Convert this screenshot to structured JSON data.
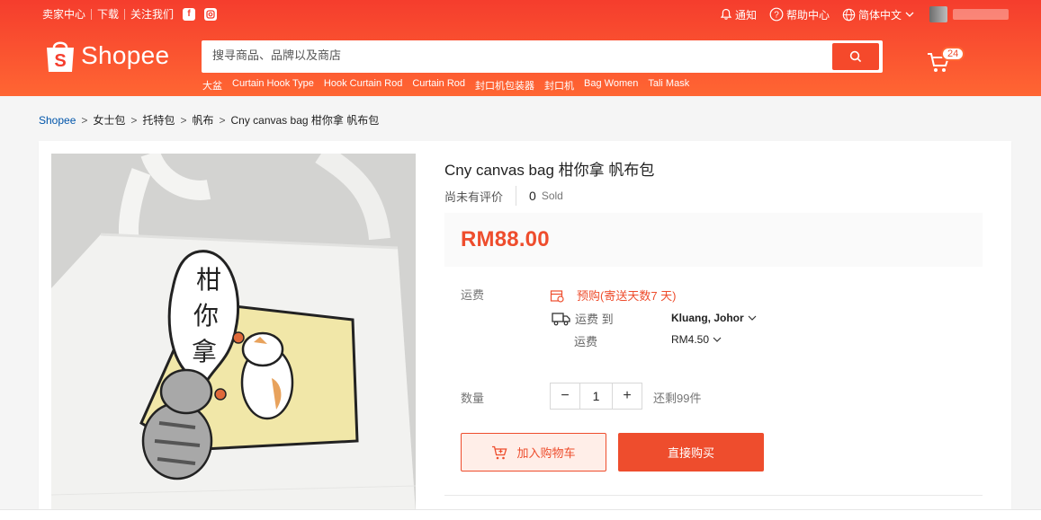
{
  "topbar": {
    "seller_centre": "卖家中心",
    "download": "下载",
    "follow_us": "关注我们",
    "notifications": "通知",
    "help": "帮助中心",
    "language": "简体中文"
  },
  "header": {
    "logo_text": "Shopee",
    "search_placeholder": "搜寻商品、品牌以及商店",
    "cart_count": "24",
    "hints": [
      "大盆",
      "Curtain Hook Type",
      "Hook Curtain Rod",
      "Curtain Rod",
      "封口机包装器",
      "封口机",
      "Bag Women",
      "Tali Mask"
    ]
  },
  "breadcrumb": {
    "items": [
      "Shopee",
      "女士包",
      "托特包",
      "帆布"
    ],
    "current": "Cny canvas bag 柑你拿 帆布包"
  },
  "product": {
    "title": "Cny canvas bag 柑你拿 帆布包",
    "no_rating": "尚未有评价",
    "sold_count": "0",
    "sold_label": "Sold",
    "price": "RM88.00",
    "shipping_label": "运费",
    "preorder_text": "预购(寄送天数7 天)",
    "ship_to_label": "运费 到",
    "ship_to_value": "Kluang, Johor",
    "ship_fee_label": "运费",
    "ship_fee_value": "RM4.50",
    "quantity_label": "数量",
    "quantity_value": "1",
    "qty_minus": "−",
    "qty_plus": "+",
    "stock_text": "还剩99件",
    "add_to_cart": "加入购物车",
    "buy_now": "直接购买",
    "image_text": {
      "speech": [
        "柑",
        "你",
        "拿"
      ]
    }
  },
  "colors": {
    "brand": "#ee4d2d",
    "header_start": "#f53d2d",
    "header_end": "#ff6633",
    "link": "#0055aa"
  },
  "icons": [
    "facebook-icon",
    "instagram-icon",
    "bell-icon",
    "help-icon",
    "globe-icon",
    "chevron-down-icon",
    "shopee-bag-icon",
    "search-icon",
    "cart-icon",
    "calendar-icon",
    "truck-icon",
    "add-cart-icon"
  ]
}
